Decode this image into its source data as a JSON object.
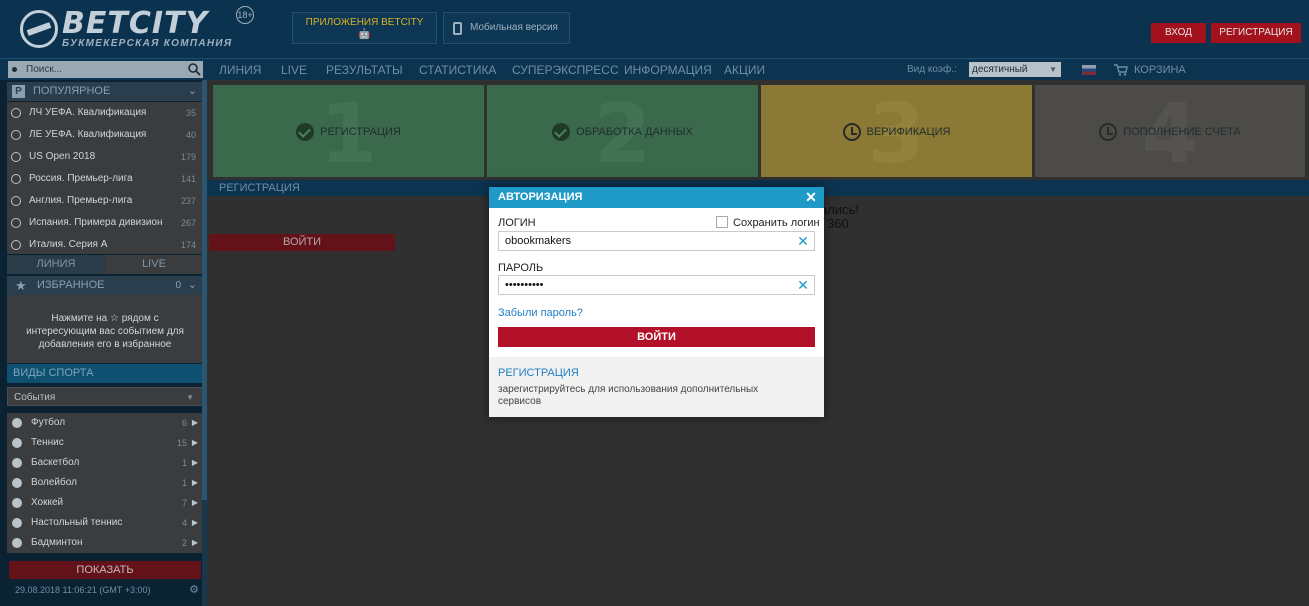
{
  "header": {
    "logo_name": "BETCITY",
    "logo_sub": "БУКМЕКЕРСКАЯ КОМПАНИЯ",
    "age_badge": "18+",
    "apps_label": "ПРИЛОЖЕНИЯ BETCITY",
    "apps_os": "🤖",
    "mobile_label": "Мобильная версия",
    "login_label": "ВХОД",
    "register_label": "РЕГИСТРАЦИЯ"
  },
  "nav": {
    "search_placeholder": "Поиск...",
    "items": [
      "ЛИНИЯ",
      "LIVE",
      "РЕЗУЛЬТАТЫ",
      "СТАТИСТИКА",
      "СУПЕРЭКСПРЕСС",
      "ИНФОРМАЦИЯ",
      "АКЦИИ"
    ],
    "coef_label": "Вид коэф.:",
    "coef_value": "десятичный",
    "cart_label": "КОРЗИНА"
  },
  "sidebar": {
    "popular_title": "ПОПУЛЯРНОЕ",
    "popular_badge": "P",
    "popular": [
      {
        "name": "ЛЧ УЕФА. Квалификация",
        "count": "35"
      },
      {
        "name": "ЛЕ УЕФА. Квалификация",
        "count": "40"
      },
      {
        "name": "US Open 2018",
        "count": "179"
      },
      {
        "name": "Россия. Премьер-лига",
        "count": "141"
      },
      {
        "name": "Англия. Премьер-лига",
        "count": "237"
      },
      {
        "name": "Испания. Примера дивизион",
        "count": "267"
      },
      {
        "name": "Италия. Серия А",
        "count": "174"
      }
    ],
    "tab_line": "ЛИНИЯ",
    "tab_live": "LIVE",
    "fav_title": "ИЗБРАННОЕ",
    "fav_count": "0",
    "fav_text": "Нажмите на ☆ рядом с интересующим вас событием для добавления его в избранное",
    "sports_title": "ВИДЫ СПОРТА",
    "events_label": "События",
    "sports": [
      {
        "name": "Футбол",
        "count": "6"
      },
      {
        "name": "Теннис",
        "count": "15"
      },
      {
        "name": "Баскетбол",
        "count": "1"
      },
      {
        "name": "Волейбол",
        "count": "1"
      },
      {
        "name": "Хоккей",
        "count": "7"
      },
      {
        "name": "Настольный теннис",
        "count": "4"
      },
      {
        "name": "Бадминтон",
        "count": "2"
      }
    ],
    "show_label": "ПОКАЗАТЬ",
    "datetime": "29.08.2018 11:06:21 (GMT +3:00)"
  },
  "steps": [
    {
      "num": "1",
      "label": "РЕГИСТРАЦИЯ",
      "state": "done"
    },
    {
      "num": "2",
      "label": "ОБРАБОТКА ДАННЫХ",
      "state": "done"
    },
    {
      "num": "3",
      "label": "ВЕРИФИКАЦИЯ",
      "state": "pending"
    },
    {
      "num": "4",
      "label": "ПОПОЛНЕНИЕ СЧЕТА",
      "state": "pending"
    }
  ],
  "main": {
    "reg_bar": "РЕГИСТРАЦИЯ",
    "login_btn": "ВОЙТИ",
    "bg_text1": "ались!",
    "bg_text2": "360"
  },
  "modal": {
    "title": "АВТОРИЗАЦИЯ",
    "close": "✕",
    "login_label": "ЛОГИН",
    "remember_label": "Сохранить логин",
    "login_value": "obookmakers",
    "password_label": "ПАРОЛЬ",
    "password_value": "••••••••••",
    "clear": "✕",
    "forgot": "Забыли пароль?",
    "submit": "ВОЙТИ",
    "foot_title": "РЕГИСТРАЦИЯ",
    "foot_text": "зарегистрируйтесь для использования дополнительных сервисов"
  }
}
